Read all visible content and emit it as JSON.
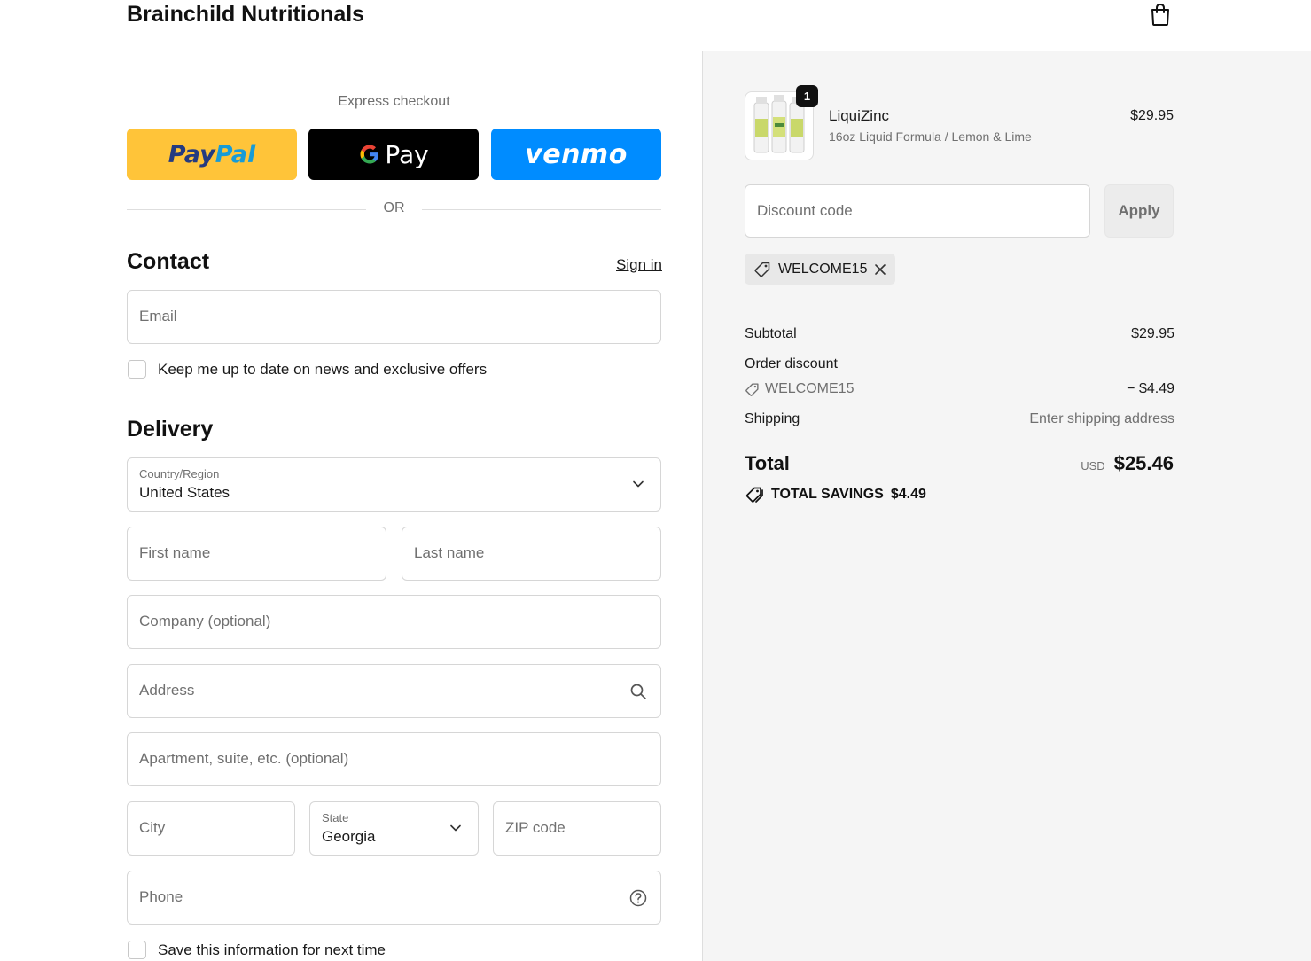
{
  "header": {
    "brand": "Brainchild Nutritionals",
    "cart_icon": "shopping-bag-icon"
  },
  "express": {
    "title": "Express checkout",
    "paypal": {
      "part1": "Pay",
      "part2": "Pal"
    },
    "gpay": {
      "label": "Pay"
    },
    "venmo": {
      "label": "venmo"
    },
    "or": "OR"
  },
  "contact": {
    "title": "Contact",
    "sign_in": "Sign in",
    "email_placeholder": "Email",
    "newsletter_label": "Keep me up to date on news and exclusive offers"
  },
  "delivery": {
    "title": "Delivery",
    "country_label": "Country/Region",
    "country_value": "United States",
    "first_name": "First name",
    "last_name": "Last name",
    "company": "Company (optional)",
    "address": "Address",
    "apartment": "Apartment, suite, etc. (optional)",
    "city": "City",
    "state_label": "State",
    "state_value": "Georgia",
    "zip": "ZIP code",
    "phone": "Phone",
    "save_info_label": "Save this information for next time"
  },
  "summary": {
    "product": {
      "name": "LiquiZinc",
      "variant": "16oz Liquid Formula / Lemon & Lime",
      "price": "$29.95",
      "quantity": "1"
    },
    "discount_placeholder": "Discount code",
    "apply_label": "Apply",
    "applied_code": "WELCOME15",
    "subtotal_label": "Subtotal",
    "subtotal_value": "$29.95",
    "order_discount_label": "Order discount",
    "order_discount_code": "WELCOME15",
    "order_discount_value": "− $4.49",
    "shipping_label": "Shipping",
    "shipping_value": "Enter shipping address",
    "total_label": "Total",
    "total_currency": "USD",
    "total_value": "$25.46",
    "savings_label": "TOTAL SAVINGS",
    "savings_value": "$4.49"
  }
}
